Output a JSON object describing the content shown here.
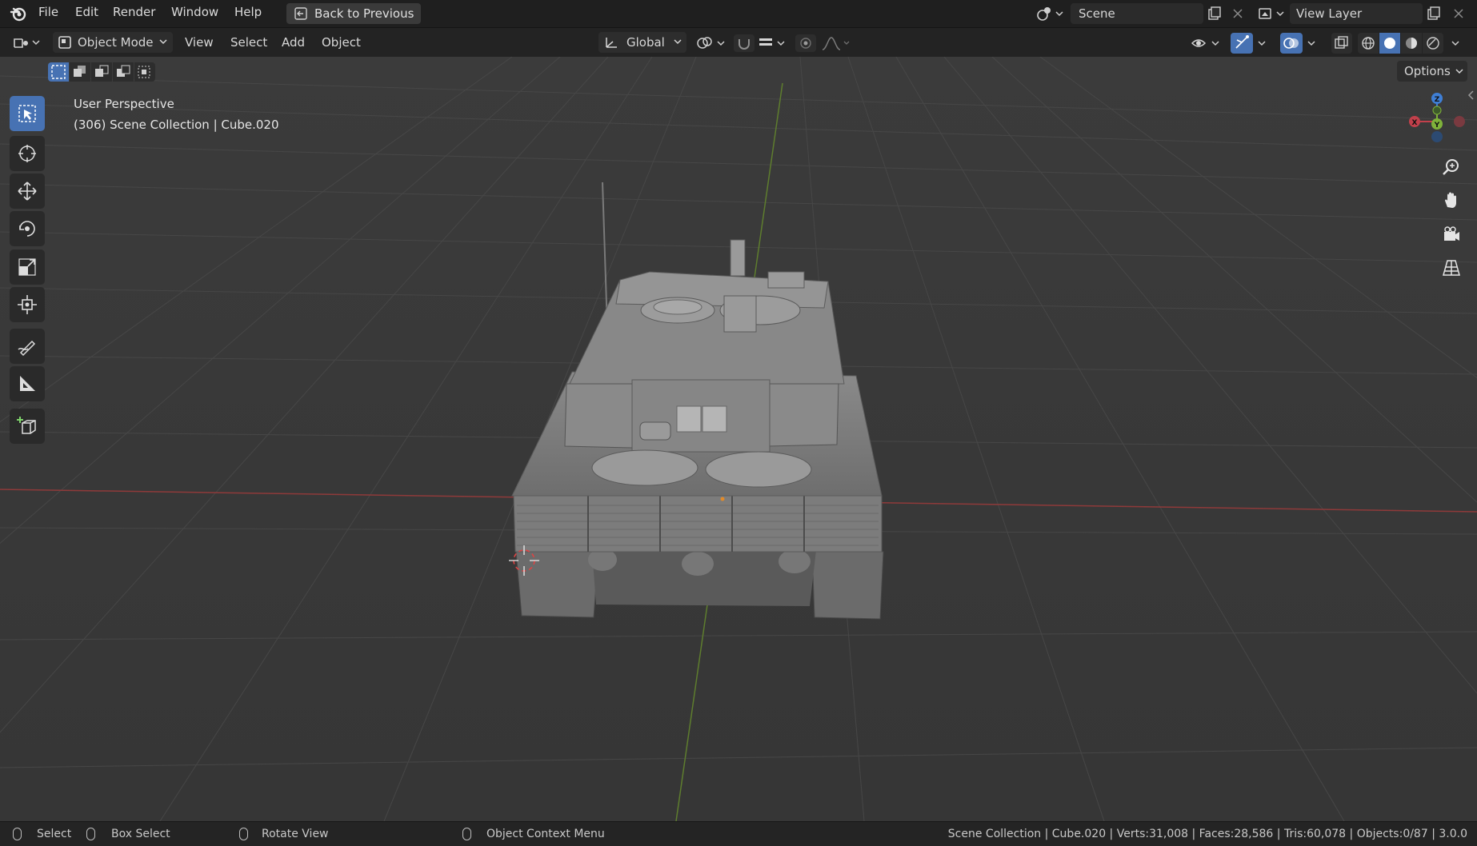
{
  "topbar": {
    "menus": [
      "File",
      "Edit",
      "Render",
      "Window",
      "Help"
    ],
    "back_button": "Back to Previous",
    "scene_label": "Scene",
    "view_layer_label": "View Layer"
  },
  "header": {
    "mode": "Object Mode",
    "menus": [
      "View",
      "Select",
      "Add",
      "Object"
    ],
    "orientation": "Global",
    "options_label": "Options"
  },
  "viewport": {
    "perspective": "User Perspective",
    "collection": "(306) Scene Collection | Cube.020",
    "gizmo_axes": {
      "z": "Z",
      "y": "Y",
      "x": "X"
    }
  },
  "toolbar": {
    "tools": [
      "select-box",
      "cursor",
      "move",
      "rotate",
      "scale",
      "transform",
      "annotate",
      "measure",
      "add-cube"
    ],
    "active": "select-box"
  },
  "status": {
    "items": [
      "Select",
      "Box Select",
      "Rotate View",
      "Object Context Menu"
    ],
    "stats": "Scene Collection | Cube.020 | Verts:31,008 | Faces:28,586 | Tris:60,078 | Objects:0/87 | 3.0.0"
  },
  "colors": {
    "accent": "#4772b3",
    "x_axis": "#c2404b",
    "y_axis": "#7fb23a",
    "z_axis": "#3f7fd6",
    "viewport_bg": "#393939"
  }
}
